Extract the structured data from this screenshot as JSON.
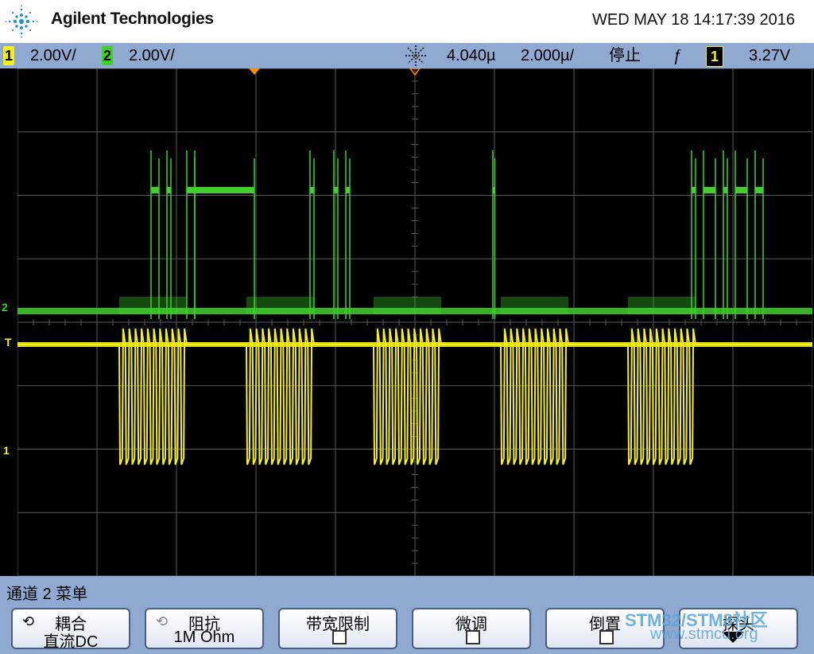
{
  "header": {
    "brand": "Agilent Technologies",
    "datetime": "WED MAY 18 14:17:39 2016"
  },
  "status": {
    "ch1_num": "1",
    "ch1_scale": "2.00V/",
    "ch2_num": "2",
    "ch2_scale": "2.00V/",
    "time_pos": "4.040µ",
    "time_scale": "2.000µ/",
    "run_state": "停止",
    "trig_slope": "ƒ",
    "trig_src": "1",
    "trig_level": "3.27V"
  },
  "markers": {
    "ch2": "2",
    "trig": "T",
    "ch1": "1"
  },
  "colors": {
    "ch1": "#f5ef1a",
    "ch2": "#3fd12a",
    "grid": "#5a5a5a",
    "trigger_marker": "#ff8a00"
  },
  "menu": {
    "title": "通道 2  菜单",
    "softkeys": [
      {
        "line1": "耦合",
        "line2": "直流DC",
        "icon": "cycle-icon"
      },
      {
        "line1": "阻抗",
        "line2": "1M Ohm",
        "icon": "cycle-icon"
      },
      {
        "line1": "带宽限制",
        "line2": "",
        "icon": "checkbox"
      },
      {
        "line1": "微调",
        "line2": "",
        "icon": "checkbox"
      },
      {
        "line1": "倒置",
        "line2": "",
        "icon": "checkbox"
      },
      {
        "line1": "探头",
        "line2": "",
        "icon": "down-arrow-icon"
      }
    ]
  },
  "watermark": {
    "line1": "STM32/STM8社区",
    "line2": "www.stmcu.org"
  },
  "waveform": {
    "bursts_start_us": [
      -3.4,
      -0.2,
      3.0,
      6.2,
      9.4
    ],
    "burst_len_us": 1.7,
    "pulses_per_burst": 11
  }
}
